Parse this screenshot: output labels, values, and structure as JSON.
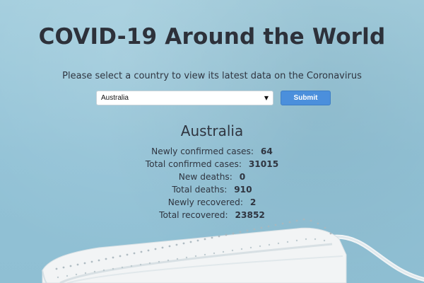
{
  "page": {
    "title": "COVID-19 Around the World",
    "subtitle": "Please select a country to view its latest data on the Coronavirus"
  },
  "form": {
    "selected_country": "Australia",
    "submit_label": "Submit"
  },
  "results": {
    "country": "Australia",
    "stats": [
      {
        "label": "Newly confirmed cases:",
        "value": "64"
      },
      {
        "label": "Total confirmed cases:",
        "value": "31015"
      },
      {
        "label": "New deaths:",
        "value": "0"
      },
      {
        "label": "Total deaths:",
        "value": "910"
      },
      {
        "label": "Newly recovered:",
        "value": "2"
      },
      {
        "label": "Total recovered:",
        "value": "23852"
      }
    ]
  },
  "colors": {
    "background": "#9cc9da",
    "submit": "#4b8fdc",
    "text": "#2f3540"
  },
  "icons": {
    "select_arrow": "chevron-down-icon",
    "mask": "surgical-mask-illustration"
  }
}
